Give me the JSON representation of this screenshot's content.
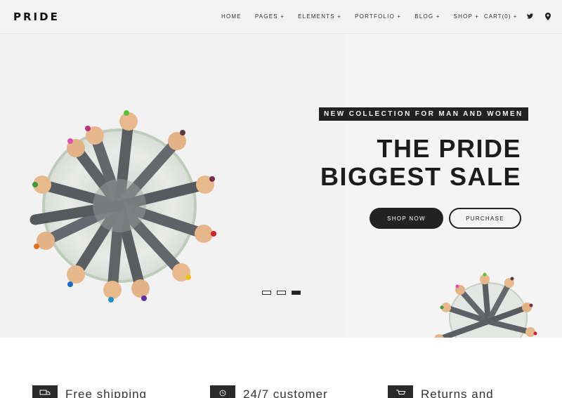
{
  "header": {
    "logo": "PRIDE",
    "nav": [
      "HOME",
      "PAGES +",
      "ELEMENTS +",
      "PORTFOLIO +",
      "BLOG +",
      "SHOP +"
    ],
    "cart": "CART(0) +",
    "icons": [
      "twitter-icon",
      "map-pin-icon"
    ]
  },
  "hero": {
    "tag": "NEW COLLECTION FOR MAN AND WOMEN",
    "title_line1": "THE PRIDE",
    "title_line2": "BIGGEST SALE",
    "primary_button": "SHOP NOW",
    "secondary_button": "PURCHASE",
    "slides": 3,
    "active_slide": 3
  },
  "features": [
    {
      "title": "Free shipping",
      "icon": "truck-icon"
    },
    {
      "title": "24/7 customer",
      "icon": "clock-icon"
    },
    {
      "title": "Returns and",
      "icon": "cart-icon"
    }
  ],
  "colors": {
    "accent": "#222222",
    "header_bg": "#f3f3f3",
    "hero_bg": "#f2f2f2"
  }
}
